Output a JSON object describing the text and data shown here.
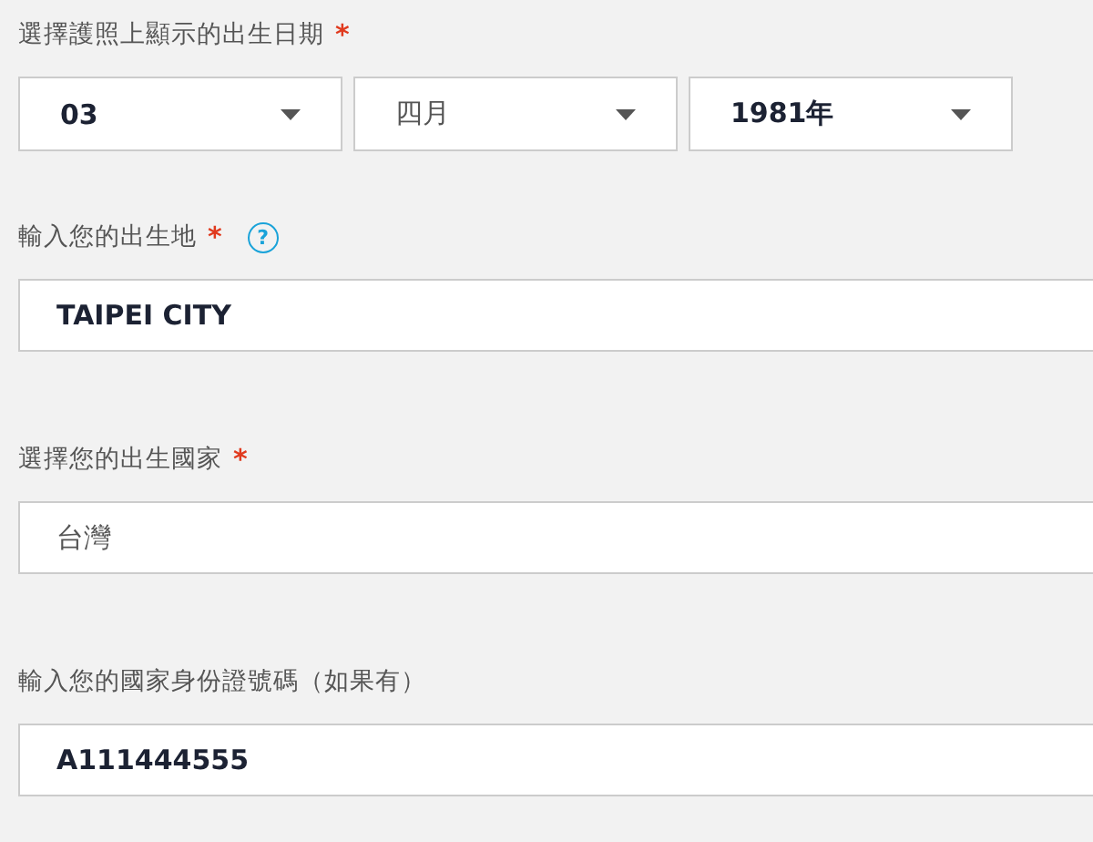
{
  "sections": [
    {
      "label": "選擇護照上顯示的出生日期",
      "required_mark": "*",
      "kind": "date",
      "selects": [
        {
          "value": "03",
          "bold": true
        },
        {
          "value": "四月",
          "bold": false
        },
        {
          "value": "1981年",
          "bold": true
        }
      ]
    },
    {
      "label": "輸入您的出生地",
      "required_mark": "*",
      "help": "?",
      "kind": "text",
      "value": "TAIPEI CITY",
      "bold": true
    },
    {
      "label": "選擇您的出生國家",
      "required_mark": "*",
      "kind": "text",
      "value": "台灣",
      "bold": false
    },
    {
      "label": "輸入您的國家身份證號碼（如果有）",
      "kind": "text",
      "value": "A111444555",
      "bold": true
    }
  ]
}
